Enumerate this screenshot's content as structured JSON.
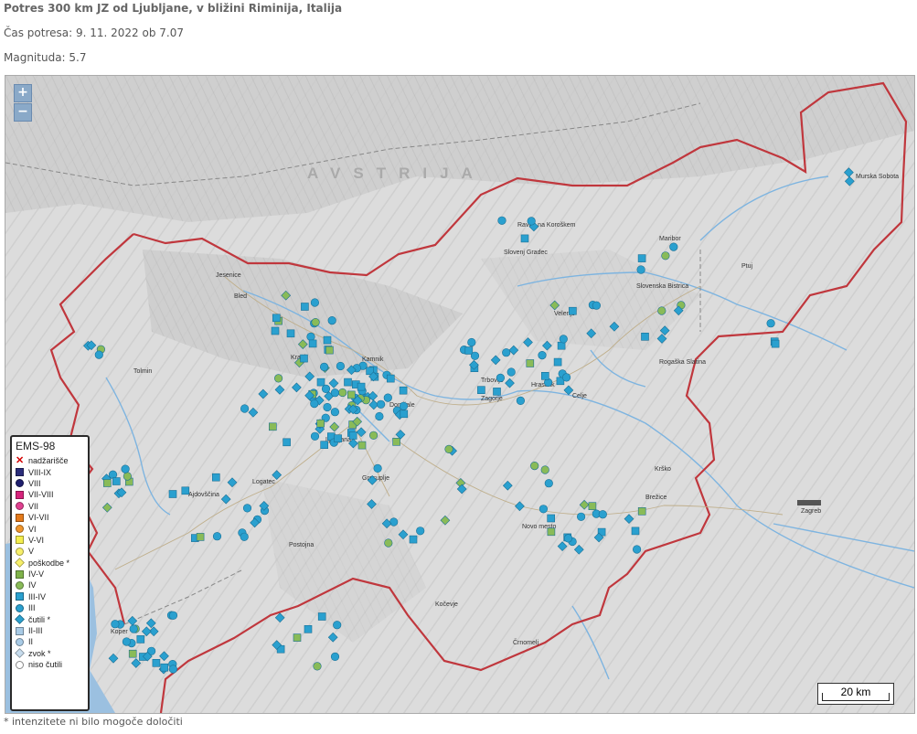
{
  "header": {
    "title": "Potres 300 km JZ od Ljubljane, v bližini Riminija, Italija",
    "time": "Čas potresa: 9. 11. 2022 ob 7.07",
    "magnitude": "Magnituda: 5.7"
  },
  "zoom": {
    "in_label": "+",
    "out_label": "−"
  },
  "legend": {
    "title": "EMS-98",
    "items": [
      {
        "label": "nadžarišče",
        "shape": "x",
        "color": "#d40000"
      },
      {
        "label": "VIII-IX",
        "shape": "square",
        "color": "#2b2d7a"
      },
      {
        "label": "VIII",
        "shape": "circle",
        "color": "#1f1f6e"
      },
      {
        "label": "VII-VIII",
        "shape": "square",
        "color": "#d6237b"
      },
      {
        "label": "VII",
        "shape": "circle",
        "color": "#e0408f"
      },
      {
        "label": "VI-VII",
        "shape": "square",
        "color": "#e47a1b"
      },
      {
        "label": "VI",
        "shape": "circle",
        "color": "#f0952b"
      },
      {
        "label": "V-VI",
        "shape": "square",
        "color": "#f4ee4e"
      },
      {
        "label": "V",
        "shape": "circle",
        "color": "#f7ef6a"
      },
      {
        "label": "poškodbe *",
        "shape": "diamond",
        "color": "#f7ef6a"
      },
      {
        "label": "IV-V",
        "shape": "square",
        "color": "#7fb24a"
      },
      {
        "label": "IV",
        "shape": "circle",
        "color": "#89bb58"
      },
      {
        "label": "III-IV",
        "shape": "square",
        "color": "#2aa0cf"
      },
      {
        "label": "III",
        "shape": "circle",
        "color": "#2aa0cf"
      },
      {
        "label": "čutili *",
        "shape": "diamond",
        "color": "#2aa0cf"
      },
      {
        "label": "II-III",
        "shape": "square",
        "color": "#a9cbe6"
      },
      {
        "label": "II",
        "shape": "circle",
        "color": "#a9cbe6"
      },
      {
        "label": "zvok *",
        "shape": "diamond",
        "color": "#c7dced"
      },
      {
        "label": "niso čutili",
        "shape": "circle-open",
        "color": "#ffffff"
      }
    ]
  },
  "places": [
    "Jesenice",
    "Bled",
    "Tolmin",
    "Kranj",
    "Kamnik",
    "Domžale",
    "Ljubljana",
    "Logatec",
    "Grosuplje",
    "Trbovlje",
    "Zagorje",
    "Hrastnik",
    "Celje",
    "Velenje",
    "Slovenj Gradec",
    "Ravne na Koroškem",
    "Maribor",
    "Ptuj",
    "Slovenska Bistrica",
    "Rogaška Slatina",
    "Murska Sobota",
    "Krško",
    "Brežice",
    "Novo mesto",
    "Kočevje",
    "Črnomelj",
    "Postojna",
    "Ajdovščina",
    "Koper",
    "Zagreb"
  ],
  "country_labels": [
    "AVSTRIJA"
  ],
  "scale": {
    "label": "20 km"
  },
  "footnote": "* intenzitete ni bilo mogoče določiti"
}
